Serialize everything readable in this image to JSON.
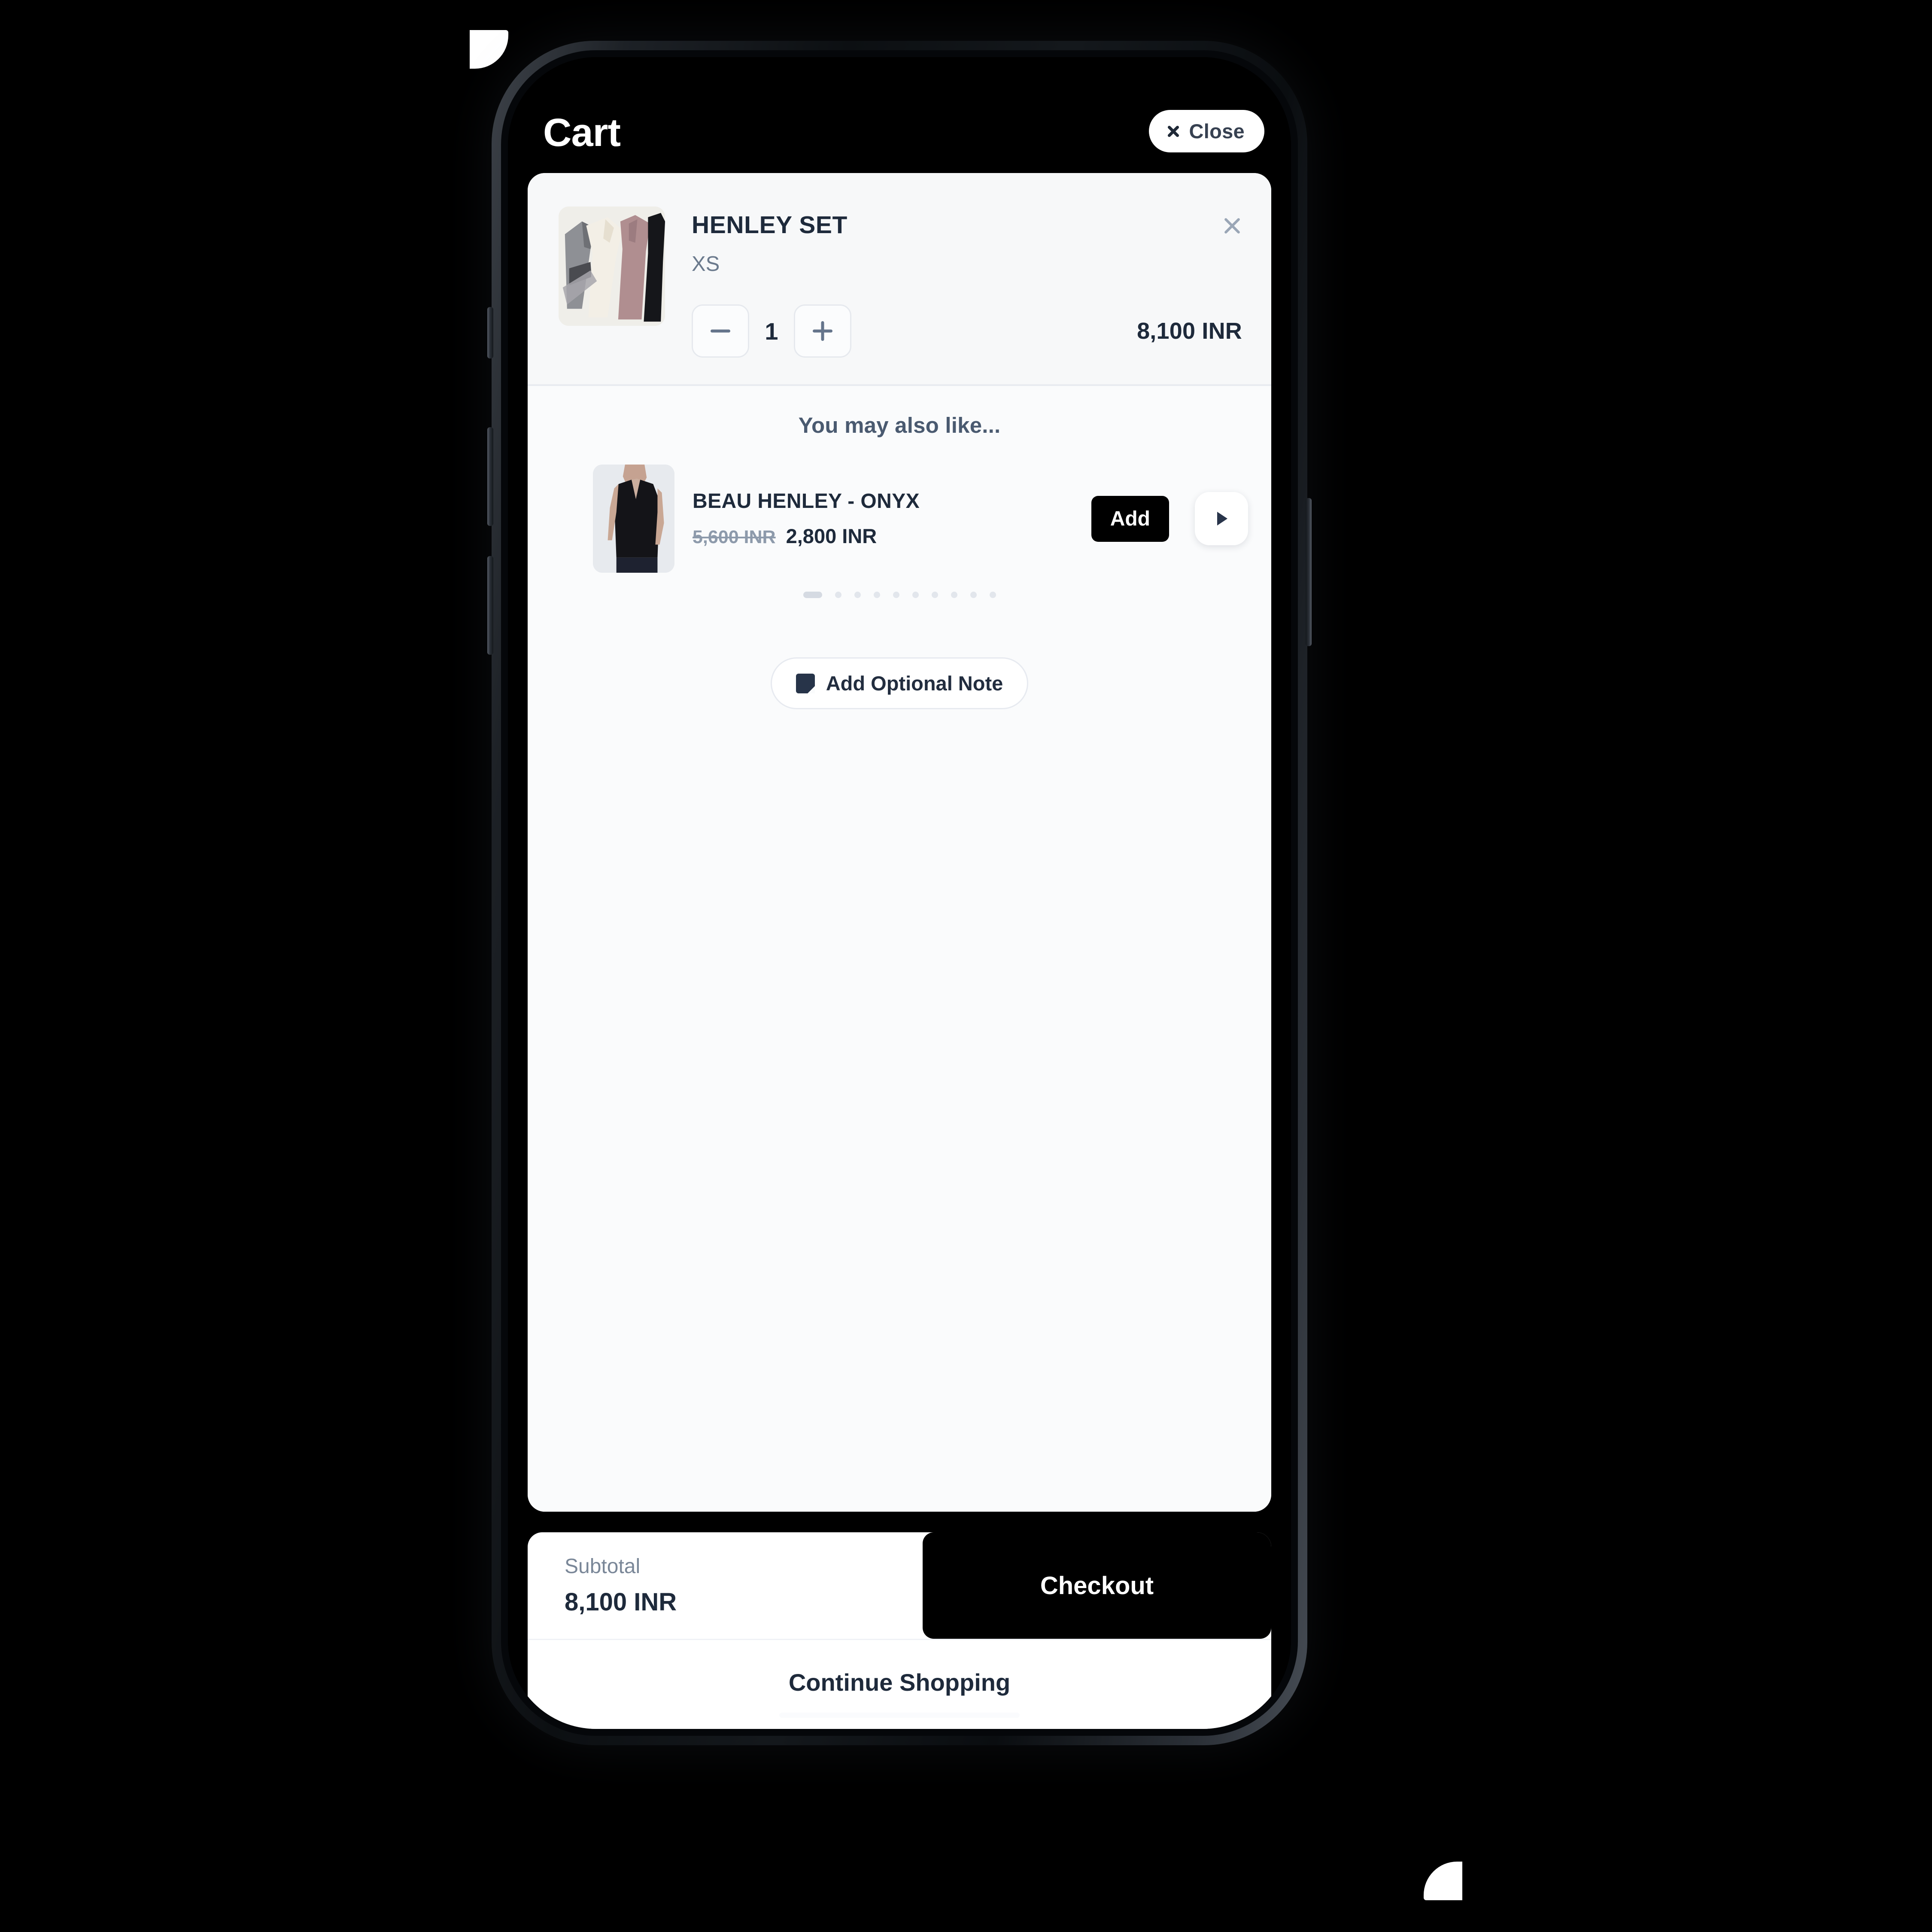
{
  "topbar": {
    "title": "Cart",
    "close_label": "Close",
    "close_icon": "close-x-icon"
  },
  "cart": {
    "items": [
      {
        "title": "HENLEY SET",
        "variant": "XS",
        "quantity": "1",
        "price": "8,100 INR",
        "remove_icon": "close-x-icon",
        "decrease_icon": "minus-icon",
        "increase_icon": "plus-icon"
      }
    ]
  },
  "recommendations": {
    "title": "You may also like...",
    "add_label": "Add",
    "next_icon": "chevron-right-icon",
    "dot_count": 10,
    "active_dot": 0,
    "products": [
      {
        "name": "BEAU HENLEY - ONYX",
        "compare_price": "5,600 INR",
        "price": "2,800 INR"
      }
    ]
  },
  "note": {
    "label": "Add Optional Note",
    "icon": "note-icon"
  },
  "footer": {
    "subtotal_label": "Subtotal",
    "subtotal_value": "8,100 INR",
    "checkout_label": "Checkout",
    "continue_label": "Continue Shopping"
  },
  "colors": {
    "background": "#000000",
    "sheet": "#fafbfc",
    "text_primary": "#1e2a3b",
    "text_muted": "#7a8798",
    "accent": "#000000",
    "card": "#ffffff"
  }
}
